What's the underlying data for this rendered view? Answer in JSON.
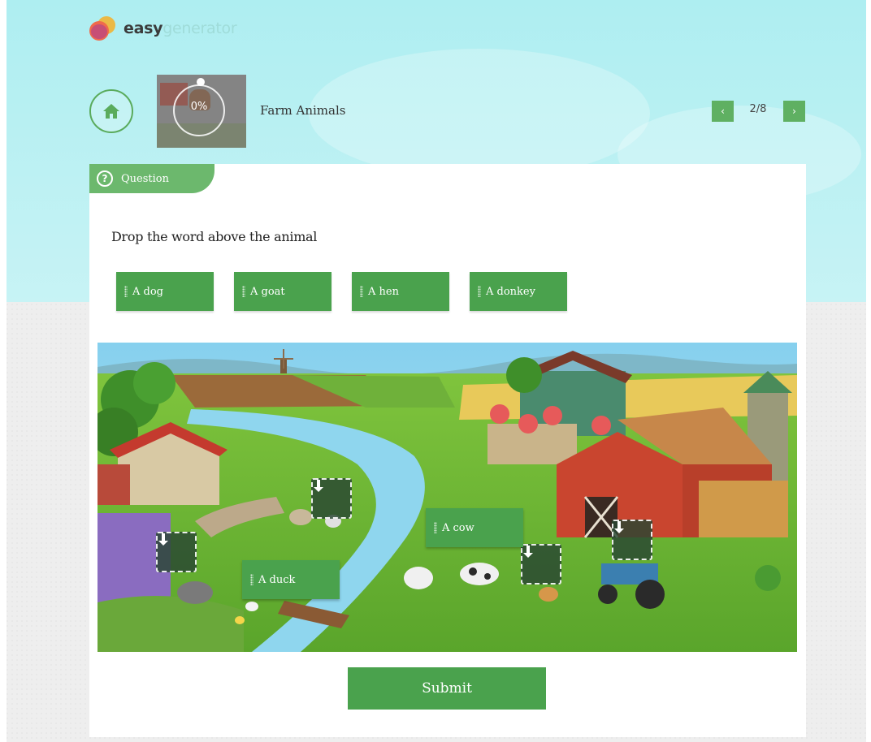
{
  "brand": {
    "part1": "easy",
    "part2": "generator"
  },
  "header": {
    "home_icon": "home-icon",
    "thumbnail_progress": "0%",
    "section_title": "Farm Animals",
    "prev_label": "‹",
    "next_label": "›",
    "counter": "2/8"
  },
  "question": {
    "tab_label": "Question",
    "tab_icon": "question-circle-icon",
    "text": "Drop the word above the animal",
    "available_words": [
      "A dog",
      "A goat",
      "A hen",
      "A donkey"
    ],
    "placed_words": [
      "A cow",
      "A duck"
    ],
    "empty_drop_zones": 4
  },
  "submit_label": "Submit",
  "colors": {
    "accent": "#4aa24d",
    "tab": "#6cb86d",
    "sky": "#aeeef1"
  }
}
